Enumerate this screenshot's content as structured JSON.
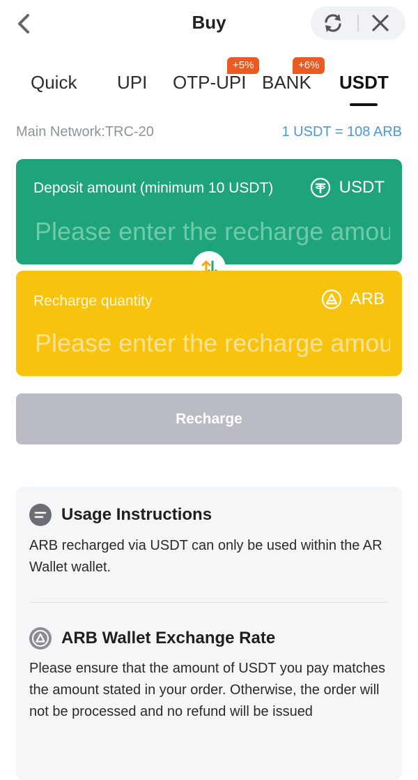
{
  "header": {
    "title": "Buy",
    "back_icon": "chevron-left-icon",
    "refresh_icon": "refresh-icon",
    "close_icon": "close-icon"
  },
  "tabs": [
    {
      "label": "Quick",
      "active": false
    },
    {
      "label": "UPI",
      "active": false
    },
    {
      "label": "OTP-UPI",
      "active": false,
      "badge": "+5%"
    },
    {
      "label": "BANK",
      "active": false,
      "badge": "+6%"
    },
    {
      "label": "USDT",
      "active": true
    }
  ],
  "network": {
    "label": "Main Network:TRC-20",
    "rate": "1 USDT = 108 ARB"
  },
  "deposit": {
    "label": "Deposit amount (minimum 10 USDT)",
    "currency": "USDT",
    "icon": "tether-icon",
    "placeholder": "Please enter the recharge amount"
  },
  "recharge_qty": {
    "label": "Recharge quantity",
    "currency": "ARB",
    "icon": "arb-icon",
    "placeholder": "Please enter the recharge amount"
  },
  "swap_icon": "swap-arrows-icon",
  "recharge_button": "Recharge",
  "info": {
    "usage": {
      "title": "Usage Instructions",
      "text": "ARB recharged via USDT can only be used within the AR Wallet wallet.",
      "icon": "message-icon"
    },
    "exchange": {
      "title": "ARB Wallet Exchange Rate",
      "text": "Please ensure that the amount of USDT you pay matches the amount stated in your order. Otherwise, the order will not be processed and no refund will be issued",
      "icon": "arb-icon"
    }
  },
  "colors": {
    "green_card": "#1ea37a",
    "yellow_card": "#f7c30e",
    "badge": "#ea5a23",
    "rate_text": "#4a97e0",
    "button_disabled": "#b9bcc4"
  }
}
